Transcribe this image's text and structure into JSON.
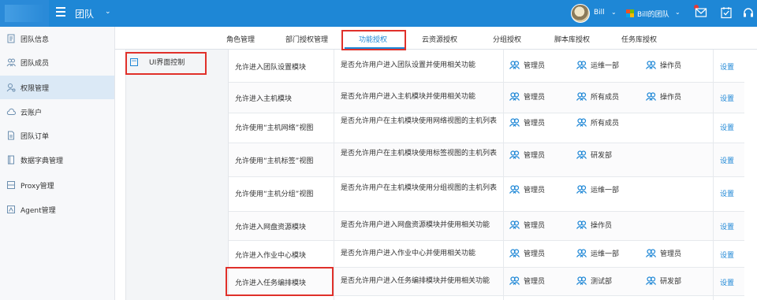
{
  "topbar": {
    "team_title": "团队",
    "user_name": "Bill",
    "team_switch": "Bill的团队"
  },
  "sidebar": {
    "items": [
      {
        "label": "团队信息",
        "icon": "id-card-icon"
      },
      {
        "label": "团队成员",
        "icon": "users-icon"
      },
      {
        "label": "权限管理",
        "icon": "user-key-icon"
      },
      {
        "label": "云账户",
        "icon": "cloud-icon"
      },
      {
        "label": "团队订单",
        "icon": "file-icon"
      },
      {
        "label": "数据字典管理",
        "icon": "book-icon"
      },
      {
        "label": "Proxy管理",
        "icon": "proxy-icon"
      },
      {
        "label": "Agent管理",
        "icon": "agent-icon"
      }
    ]
  },
  "tabs": [
    "角色管理",
    "部门授权管理",
    "功能授权",
    "云资源授权",
    "分组授权",
    "脚本库授权",
    "任务库授权"
  ],
  "tree": {
    "node_label": "UI界面控制"
  },
  "table": {
    "set_label": "设置",
    "rows": [
      {
        "name": "允许进入团队设置模块",
        "desc": "是否允许用户进入团队设置并使用相关功能",
        "members": [
          "管理员",
          "运维一部",
          "操作员"
        ]
      },
      {
        "name": "允许进入主机模块",
        "desc": "是否允许用户进入主机模块并使用相关功能",
        "members": [
          "管理员",
          "所有成员",
          "操作员"
        ]
      },
      {
        "name": "允许使用“主机网络”视图",
        "desc": "是否允许用户在主机模块使用网络视图的主机列表",
        "members": [
          "管理员",
          "所有成员"
        ]
      },
      {
        "name": "允许使用“主机标签”视图",
        "desc": "是否允许用户在主机模块使用标签视图的主机列表",
        "members": [
          "管理员",
          "研发部"
        ]
      },
      {
        "name": "允许使用“主机分组”视图",
        "desc": "是否允许用户在主机模块使用分组视图的主机列表",
        "members": [
          "管理员",
          "运维一部"
        ]
      },
      {
        "name": "允许进入网盘资源模块",
        "desc": "是否允许用户进入网盘资源模块并使用相关功能",
        "members": [
          "管理员",
          "操作员"
        ]
      },
      {
        "name": "允许进入作业中心模块",
        "desc": "是否允许用户进入作业中心并使用相关功能",
        "members": [
          "管理员",
          "运维一部",
          "管理员"
        ]
      },
      {
        "name": "允许进入任务编排模块",
        "desc": "是否允许用户进入任务编排模块并使用相关功能",
        "members": [
          "管理员",
          "测试部",
          "研发部"
        ]
      }
    ]
  },
  "colors": {
    "accent": "#1e87d6",
    "highlight": "#e0302a",
    "topbar": "#1e87d6"
  }
}
